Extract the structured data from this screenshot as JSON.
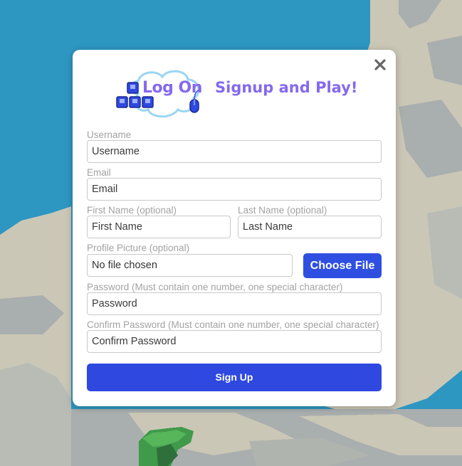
{
  "colors": {
    "accent_purple": "#8569ee",
    "button_blue": "#2e48e0",
    "label_gray": "#a2a2a2",
    "sky": "#2d97c2",
    "rock": "#cbc7b6"
  },
  "background": {
    "description_icon": "pixel-landscape"
  },
  "modal": {
    "close_icon": "close-icon",
    "logo": {
      "icon": "keyboard-mouse-cloud-logo",
      "text": "Log On"
    },
    "tagline": "Signup and Play!"
  },
  "form": {
    "username": {
      "label": "Username",
      "placeholder": "Username"
    },
    "email": {
      "label": "Email",
      "placeholder": "Email"
    },
    "first_name": {
      "label": "First Name (optional)",
      "placeholder": "First Name"
    },
    "last_name": {
      "label": "Last Name (optional)",
      "placeholder": "Last Name"
    },
    "profile_picture": {
      "label": "Profile Picture (optional)",
      "status": "No file chosen",
      "button_label": "Choose File"
    },
    "password": {
      "label": "Password (Must contain one number, one special character)",
      "placeholder": "Password"
    },
    "confirm_password": {
      "label": "Confirm Password (Must contain one number, one special character)",
      "placeholder": "Confirm Password"
    },
    "submit_label": "Sign Up"
  }
}
